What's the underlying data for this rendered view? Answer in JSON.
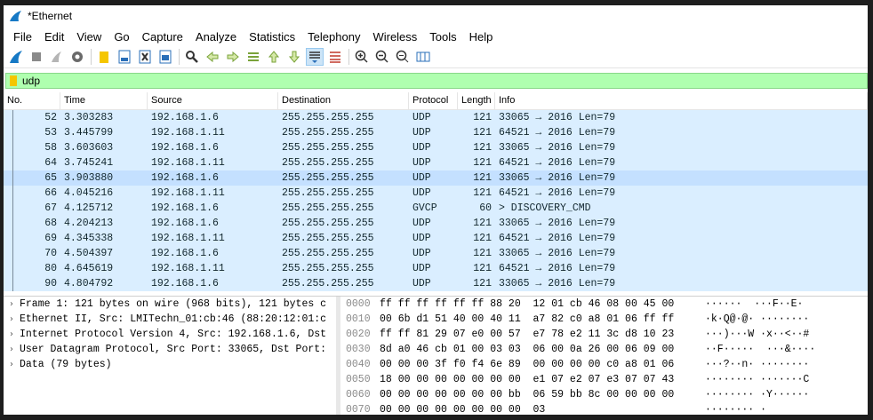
{
  "window": {
    "title": "*Ethernet"
  },
  "menu": [
    "File",
    "Edit",
    "View",
    "Go",
    "Capture",
    "Analyze",
    "Statistics",
    "Telephony",
    "Wireless",
    "Tools",
    "Help"
  ],
  "toolbar_icons": [
    "start-capture-icon",
    "stop-capture-icon",
    "restart-capture-icon",
    "capture-options-icon",
    "open-file-icon",
    "save-file-icon",
    "close-file-icon",
    "reload-file-icon",
    "find-packet-icon",
    "go-back-icon",
    "go-forward-icon",
    "go-to-packet-icon",
    "first-packet-icon",
    "last-packet-icon",
    "autoscroll-icon",
    "colorize-icon",
    "zoom-in-icon",
    "zoom-out-icon",
    "normal-size-icon",
    "resize-columns-icon"
  ],
  "filter": {
    "value": "udp"
  },
  "columns": [
    "No.",
    "Time",
    "Source",
    "Destination",
    "Protocol",
    "Length",
    "Info"
  ],
  "packets": [
    [
      "52",
      "3.303283",
      "192.168.1.6",
      "255.255.255.255",
      "UDP",
      "121",
      "33065 → 2016 Len=79"
    ],
    [
      "53",
      "3.445799",
      "192.168.1.11",
      "255.255.255.255",
      "UDP",
      "121",
      "64521 → 2016 Len=79"
    ],
    [
      "58",
      "3.603603",
      "192.168.1.6",
      "255.255.255.255",
      "UDP",
      "121",
      "33065 → 2016 Len=79"
    ],
    [
      "64",
      "3.745241",
      "192.168.1.11",
      "255.255.255.255",
      "UDP",
      "121",
      "64521 → 2016 Len=79"
    ],
    [
      "65",
      "3.903880",
      "192.168.1.6",
      "255.255.255.255",
      "UDP",
      "121",
      "33065 → 2016 Len=79"
    ],
    [
      "66",
      "4.045216",
      "192.168.1.11",
      "255.255.255.255",
      "UDP",
      "121",
      "64521 → 2016 Len=79"
    ],
    [
      "67",
      "4.125712",
      "192.168.1.6",
      "255.255.255.255",
      "GVCP",
      "60",
      "> DISCOVERY_CMD"
    ],
    [
      "68",
      "4.204213",
      "192.168.1.6",
      "255.255.255.255",
      "UDP",
      "121",
      "33065 → 2016 Len=79"
    ],
    [
      "69",
      "4.345338",
      "192.168.1.11",
      "255.255.255.255",
      "UDP",
      "121",
      "64521 → 2016 Len=79"
    ],
    [
      "70",
      "4.504397",
      "192.168.1.6",
      "255.255.255.255",
      "UDP",
      "121",
      "33065 → 2016 Len=79"
    ],
    [
      "80",
      "4.645619",
      "192.168.1.11",
      "255.255.255.255",
      "UDP",
      "121",
      "64521 → 2016 Len=79"
    ],
    [
      "90",
      "4.804792",
      "192.168.1.6",
      "255.255.255.255",
      "UDP",
      "121",
      "33065 → 2016 Len=79"
    ]
  ],
  "selected_packet_index": 4,
  "details": [
    "Frame 1: 121 bytes on wire (968 bits), 121 bytes c",
    "Ethernet II, Src: LMITechn_01:cb:46 (88:20:12:01:c",
    "Internet Protocol Version 4, Src: 192.168.1.6, Dst",
    "User Datagram Protocol, Src Port: 33065, Dst Port:",
    "Data (79 bytes)"
  ],
  "hexdump": [
    [
      "0000",
      "ff ff ff ff ff ff 88 20  12 01 cb 46 08 00 45 00",
      "······  ···F··E·"
    ],
    [
      "0010",
      "00 6b d1 51 40 00 40 11  a7 82 c0 a8 01 06 ff ff",
      "·k·Q@·@· ········"
    ],
    [
      "0020",
      "ff ff 81 29 07 e0 00 57  e7 78 e2 11 3c d8 10 23",
      "···)···W ·x··<··#"
    ],
    [
      "0030",
      "8d a0 46 cb 01 00 03 03  06 00 0a 26 00 06 09 00",
      "··F·····  ···&····"
    ],
    [
      "0040",
      "00 00 00 3f f0 f4 6e 89  00 00 00 00 c0 a8 01 06",
      "···?··n· ········"
    ],
    [
      "0050",
      "18 00 00 00 00 00 00 00  e1 07 e2 07 e3 07 07 43",
      "········ ·······C"
    ],
    [
      "0060",
      "00 00 00 00 00 00 00 bb  06 59 bb 8c 00 00 00 00",
      "········ ·Y······"
    ],
    [
      "0070",
      "00 00 00 00 00 00 00 00  03",
      "········ ·"
    ]
  ]
}
